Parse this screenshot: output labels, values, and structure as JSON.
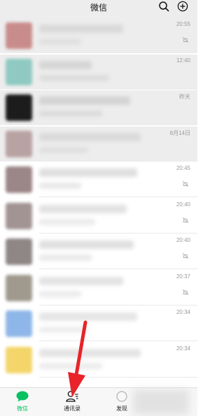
{
  "header": {
    "title": "微信"
  },
  "chats": [
    {
      "time": "20:55",
      "muted": true,
      "pinned": true,
      "avatar": "#c98c8c",
      "name_w": 120,
      "msg_w": 60,
      "tone": "#cfcfcf"
    },
    {
      "time": "12:40",
      "muted": false,
      "pinned": true,
      "avatar": "#8fc9c1",
      "name_w": 75,
      "msg_w": 100,
      "tone": "#c9c9c9"
    },
    {
      "time": "昨天",
      "muted": false,
      "pinned": true,
      "avatar": "#1c1c1c",
      "name_w": 130,
      "msg_w": 90,
      "tone": "#c6c6c6"
    },
    {
      "time": "8月14日",
      "muted": false,
      "pinned": true,
      "avatar": "#b9a2a2",
      "name_w": 145,
      "msg_w": 70,
      "tone": "#d0d0d0"
    },
    {
      "time": "20:45",
      "muted": true,
      "pinned": false,
      "avatar": "#9b8787",
      "name_w": 140,
      "msg_w": 60,
      "tone": "#cdcdcd"
    },
    {
      "time": "20:40",
      "muted": true,
      "pinned": false,
      "avatar": "#a39494",
      "name_w": 125,
      "msg_w": 80,
      "tone": "#d2d2d2"
    },
    {
      "time": "20:40",
      "muted": true,
      "pinned": false,
      "avatar": "#8f8686",
      "name_w": 135,
      "msg_w": 75,
      "tone": "#cfcfcf"
    },
    {
      "time": "20:37",
      "muted": true,
      "pinned": false,
      "avatar": "#a09a8e",
      "name_w": 120,
      "msg_w": 60,
      "tone": "#d4d4d4"
    },
    {
      "time": "20:34",
      "muted": false,
      "pinned": false,
      "avatar": "#8fb6e8",
      "name_w": 140,
      "msg_w": 70,
      "tone": "#d8d8d8"
    },
    {
      "time": "20:34",
      "muted": false,
      "pinned": false,
      "avatar": "#f3d56a",
      "name_w": 145,
      "msg_w": 90,
      "tone": "#d6d6d6"
    }
  ],
  "tabbar": {
    "tabs": [
      {
        "label": "微信",
        "active": true
      },
      {
        "label": "通讯录",
        "active": false
      },
      {
        "label": "发现",
        "active": false
      }
    ]
  },
  "colors": {
    "accent": "#07c160",
    "arrow": "#e8232a"
  }
}
